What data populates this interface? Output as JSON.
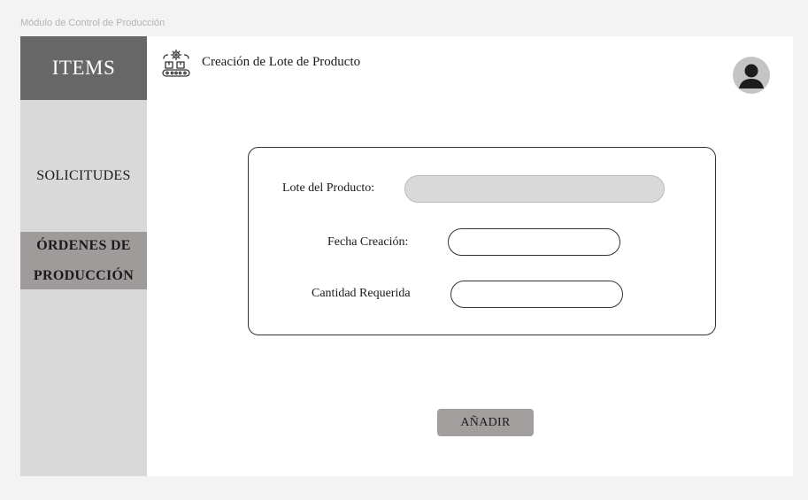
{
  "frame_label": "Módulo de Control de Producción",
  "sidebar": {
    "header": "ITEMS",
    "items": [
      {
        "label": "SOLICITUDES",
        "active": false
      },
      {
        "label": "ÓRDENES DE PRODUCCIÓN",
        "active": true
      }
    ]
  },
  "header": {
    "title": "Creación de Lote de Producto",
    "icon": "production-line-icon"
  },
  "form": {
    "lote_label": "Lote del Producto:",
    "lote_value": "",
    "fecha_label": "Fecha Creación:",
    "fecha_value": "",
    "cantidad_label": "Cantidad Requerida",
    "cantidad_value": ""
  },
  "add_button_label": "AÑADIR",
  "colors": {
    "sidebar_header_bg": "#676767",
    "sidebar_bg": "#d9d9d9",
    "active_item_bg": "#a09b9b",
    "button_bg": "#a39e9e",
    "disabled_input_bg": "#d9d9d9"
  }
}
